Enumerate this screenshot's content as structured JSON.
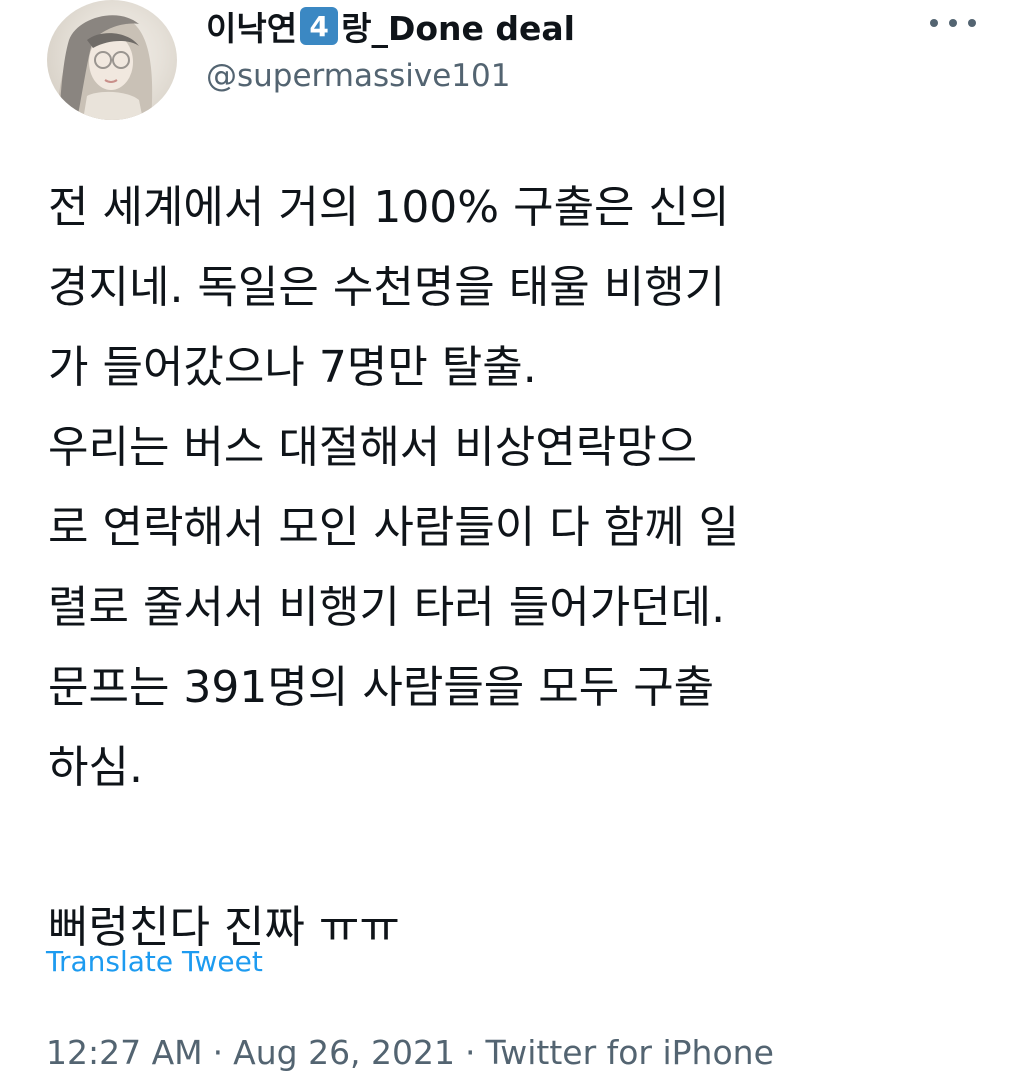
{
  "author": {
    "display_name_prefix": "이낙연",
    "keycap_digit": "4",
    "display_name_suffix": "랑_Done deal",
    "handle": "@supermassive101",
    "avatar_icon": "avatar-illustration-icon",
    "more_icon": "more-options-icon"
  },
  "tweet": {
    "lines": [
      "전 세계에서 거의 100% 구출은 신의",
      "경지네. 독일은 수천명을 태울 비행기",
      "가 들어갔으나 7명만 탈출.",
      "우리는 버스 대절해서 비상연락망으",
      "로 연락해서 모인 사람들이 다 함께 일",
      "렬로 줄서서 비행기 타러 들어가던데.",
      "문프는 391명의 사람들을 모두 구출",
      "하심."
    ],
    "final_line": "뻐렁친다 진짜 ㅠㅠ",
    "translate_label": "Translate Tweet"
  },
  "meta": {
    "time": "12:27 AM",
    "date": "Aug 26, 2021",
    "separator": "·",
    "source": "Twitter for iPhone"
  },
  "colors": {
    "text": "#0f1419",
    "secondary": "#536471",
    "link": "#1d9bf0",
    "keycap": "#3b88c3"
  }
}
